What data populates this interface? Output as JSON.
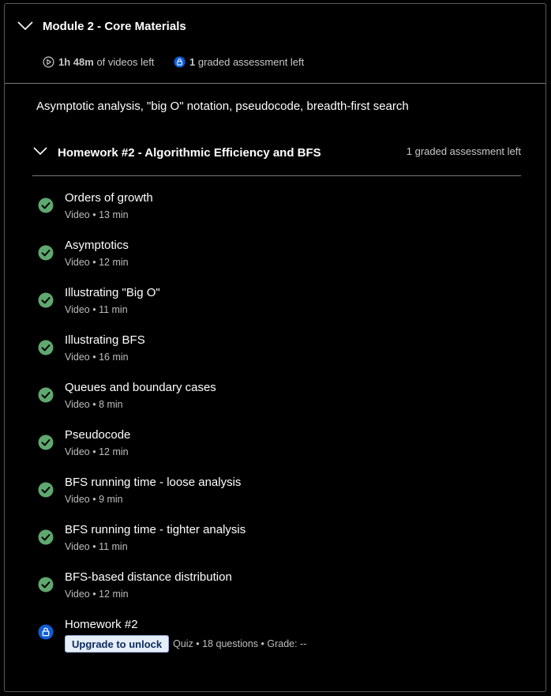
{
  "module": {
    "title": "Module 2 - Core Materials",
    "videos_left_value": "1h 48m",
    "videos_left_suffix": "of videos left",
    "graded_left_value": "1",
    "graded_left_suffix": "graded assessment left",
    "description": "Asymptotic analysis, \"big O\" notation, pseudocode, breadth-first search"
  },
  "lesson": {
    "title": "Homework #2 - Algorithmic Efficiency and BFS",
    "status": "1 graded assessment left"
  },
  "items": [
    {
      "title": "Orders of growth",
      "meta": "Video • 13 min",
      "icon": "check-circle-icon"
    },
    {
      "title": "Asymptotics",
      "meta": "Video • 12 min",
      "icon": "check-circle-icon"
    },
    {
      "title": "Illustrating \"Big O\"",
      "meta": "Video • 11 min",
      "icon": "check-circle-icon"
    },
    {
      "title": "Illustrating BFS",
      "meta": "Video • 16 min",
      "icon": "check-circle-icon"
    },
    {
      "title": "Queues and boundary cases",
      "meta": "Video • 8 min",
      "icon": "check-circle-icon"
    },
    {
      "title": "Pseudocode",
      "meta": "Video • 12 min",
      "icon": "check-circle-icon"
    },
    {
      "title": "BFS running time - loose analysis",
      "meta": "Video • 9 min",
      "icon": "check-circle-icon"
    },
    {
      "title": "BFS running time - tighter analysis",
      "meta": "Video • 11 min",
      "icon": "check-circle-icon"
    },
    {
      "title": "BFS-based distance distribution",
      "meta": "Video • 12 min",
      "icon": "check-circle-icon"
    }
  ],
  "homework": {
    "title": "Homework #2",
    "button_label": "Upgrade to unlock",
    "meta": "Quiz • 18 questions • Grade: --",
    "icon": "lock-icon"
  },
  "colors": {
    "background": "#000000",
    "check": "#5fa86f",
    "lock": "#0f5ed6",
    "button_bg": "#e6eefb",
    "divider": "#7a7a7a"
  }
}
